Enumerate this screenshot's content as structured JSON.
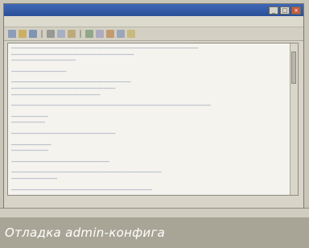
{
  "caption": "Отладка admin-конфига",
  "colors": {
    "caption_bg": "#a8a596",
    "titlebar": "#2a4f98",
    "editor_text": "#4a5a8c"
  },
  "icons": [
    "close-icon",
    "maximize-icon",
    "minimize-icon"
  ]
}
